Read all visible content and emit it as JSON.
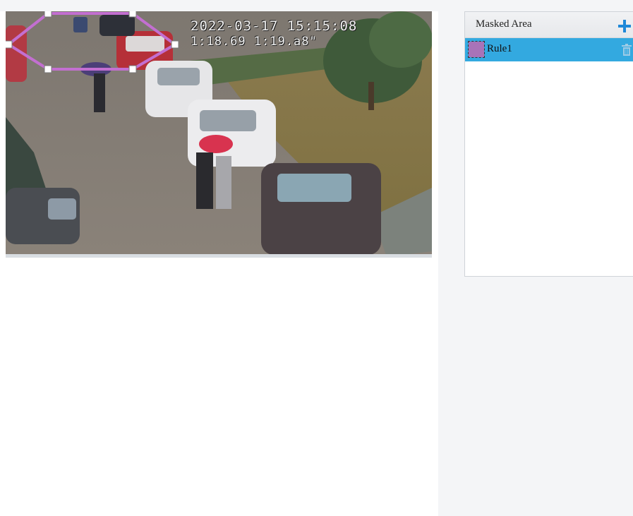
{
  "video": {
    "osd_datetime": "2022-03-17 15:15:08",
    "osd_sub": "1:18.69   1:19.a8\"",
    "mask_color": "#c36fd1"
  },
  "panel": {
    "title": "Masked Area",
    "add_icon": "plus-icon",
    "rules": [
      {
        "name": "Rule1",
        "color": "#a873b8",
        "selected": true,
        "delete_icon": "trash-icon"
      }
    ],
    "selected_row_color": "#33a9e0"
  }
}
